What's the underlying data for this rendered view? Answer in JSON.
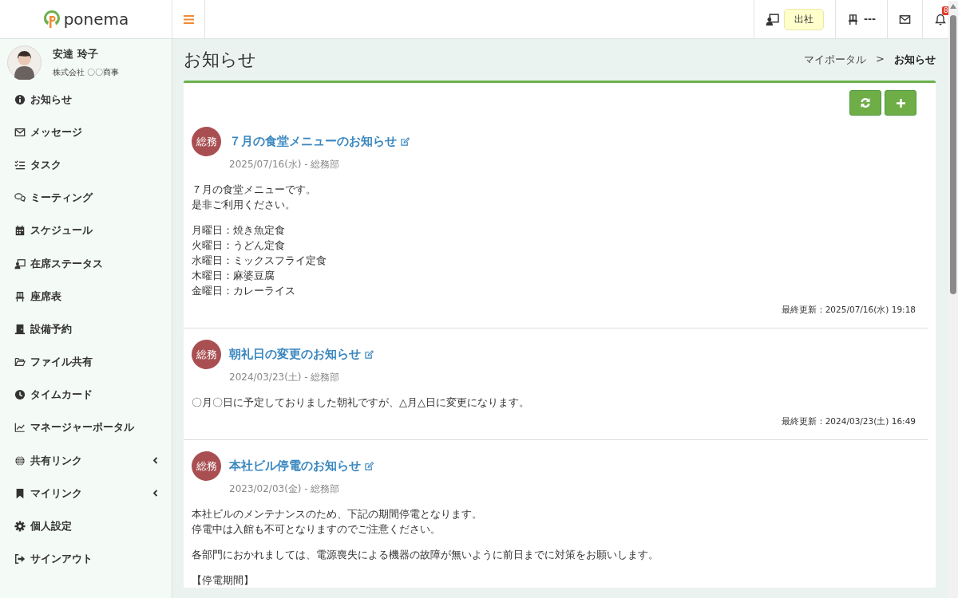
{
  "app": {
    "logo": "ponema"
  },
  "topbar": {
    "status": "出社",
    "seat": "---",
    "notification_count": "8"
  },
  "user": {
    "name": "安達 玲子",
    "company": "株式会社 〇〇商事"
  },
  "sidebar": {
    "items": [
      {
        "label": "お知らせ",
        "kind": "link"
      },
      {
        "label": "メッセージ",
        "kind": "link"
      },
      {
        "label": "タスク",
        "kind": "link"
      },
      {
        "label": "ミーティング",
        "kind": "link"
      },
      {
        "label": "スケジュール",
        "kind": "link"
      },
      {
        "label": "在席ステータス",
        "kind": "link"
      },
      {
        "label": "座席表",
        "kind": "link"
      },
      {
        "label": "設備予約",
        "kind": "link"
      },
      {
        "label": "ファイル共有",
        "kind": "link"
      },
      {
        "label": "タイムカード",
        "kind": "link"
      },
      {
        "label": "マネージャーポータル",
        "kind": "link"
      },
      {
        "label": "共有リンク",
        "kind": "group"
      },
      {
        "label": "マイリンク",
        "kind": "group"
      },
      {
        "label": "個人設定",
        "kind": "link"
      },
      {
        "label": "サインアウト",
        "kind": "link"
      }
    ]
  },
  "page": {
    "title": "お知らせ",
    "breadcrumb": [
      {
        "label": "マイポータル",
        "current": false
      },
      {
        "label": "お知らせ",
        "current": true
      }
    ],
    "breadcrumb_separator": ">"
  },
  "posts": [
    {
      "badge": "総務",
      "title": "７月の食堂メニューのお知らせ",
      "meta": "2025/07/16(水) - 総務部",
      "paragraphs": [
        [
          "７月の食堂メニューです。",
          "是非ご利用ください。"
        ],
        [
          "月曜日：焼き魚定食",
          "火曜日：うどん定食",
          "水曜日：ミックスフライ定食",
          "木曜日：麻婆豆腐",
          "金曜日：カレーライス"
        ]
      ],
      "updated": "最終更新：2025/07/16(水) 19:18"
    },
    {
      "badge": "総務",
      "title": "朝礼日の変更のお知らせ",
      "meta": "2024/03/23(土) - 総務部",
      "paragraphs": [
        [
          "〇月〇日に予定しておりました朝礼ですが、△月△日に変更になります。"
        ]
      ],
      "updated": "最終更新：2024/03/23(土) 16:49"
    },
    {
      "badge": "総務",
      "title": "本社ビル停電のお知らせ",
      "meta": "2023/02/03(金) - 総務部",
      "paragraphs": [
        [
          "本社ビルのメンテナンスのため、下記の期間停電となります。",
          "停電中は入館も不可となりますのでご注意ください。"
        ],
        [
          "各部門におかれましては、電源喪失による機器の故障が無いように前日までに対策をお願いします。"
        ],
        [
          "【停電期間】"
        ]
      ]
    }
  ]
}
